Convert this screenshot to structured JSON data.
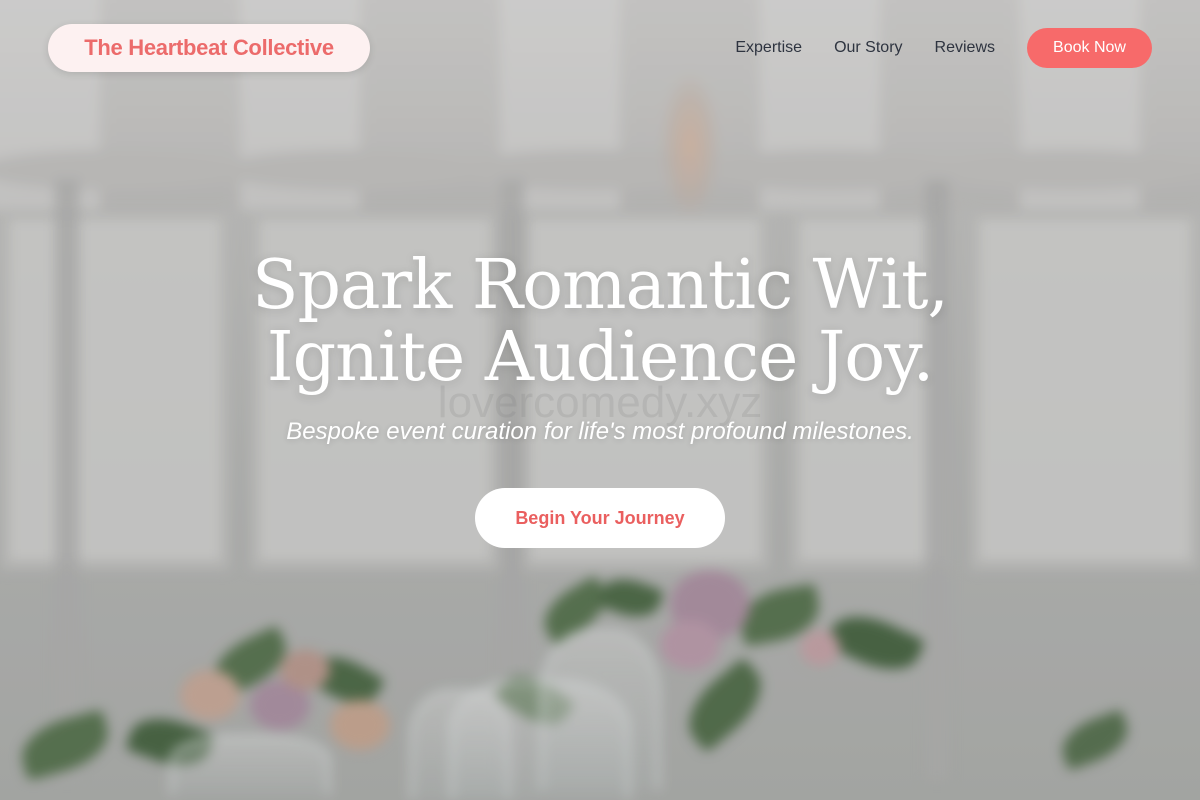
{
  "brand": {
    "name": "The Heartbeat Collective",
    "color": "#ec6b6b"
  },
  "nav": {
    "items": [
      {
        "label": "Expertise"
      },
      {
        "label": "Our Story"
      },
      {
        "label": "Reviews"
      }
    ],
    "cta_label": "Book Now",
    "cta_color": "#f76a6a"
  },
  "hero": {
    "headline_line1": "Spark Romantic Wit,",
    "headline_line2": "Ignite Audience Joy.",
    "watermark": "lovercomedy.xyz",
    "subheadline": "Bespoke event curation for life's most profound milestones.",
    "cta_label": "Begin Your Journey"
  },
  "background": {
    "description_icon": "wedding-table-image"
  }
}
